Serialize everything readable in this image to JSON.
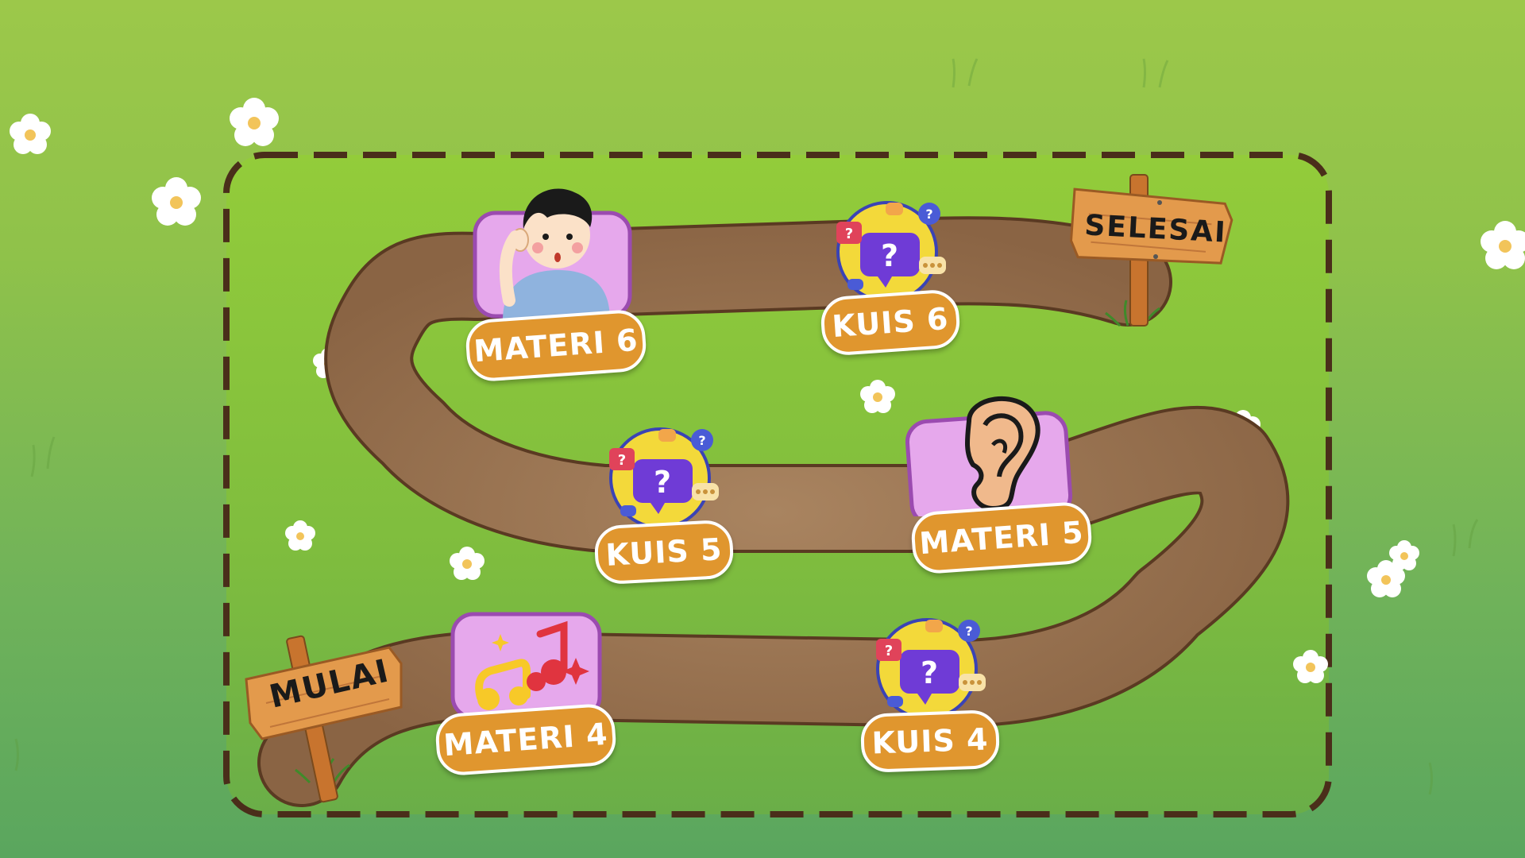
{
  "start_sign": "MULAI",
  "end_sign": "SELESAI",
  "nodes": [
    {
      "kind": "materi",
      "label": "MATERI 4",
      "picture": "music-notes-icon"
    },
    {
      "kind": "kuis",
      "label": "KUIS 4",
      "picture": "question-chat-icon"
    },
    {
      "kind": "materi",
      "label": "MATERI 5",
      "picture": "ear-icon"
    },
    {
      "kind": "kuis",
      "label": "KUIS 5",
      "picture": "question-chat-icon"
    },
    {
      "kind": "materi",
      "label": "MATERI 6",
      "picture": "listening-boy-icon"
    },
    {
      "kind": "kuis",
      "label": "KUIS 6",
      "picture": "question-chat-icon"
    }
  ],
  "colors": {
    "grass": "#8fc24a",
    "path": "#9a7350",
    "border": "#4a2e1a",
    "label_bg": "#e0962e",
    "label_text": "#ffffff",
    "card_bg": "#e6a8ec",
    "quiz_circle": "#f3d93a",
    "sign_wood": "#e39a4c"
  }
}
